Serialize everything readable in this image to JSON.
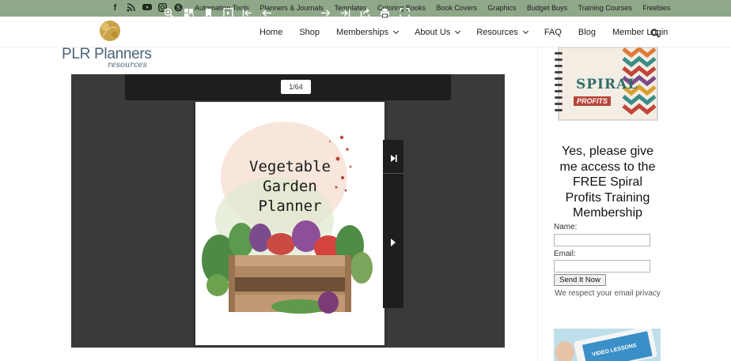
{
  "topbar": {
    "social_icons": [
      "facebook-icon",
      "rss-icon",
      "youtube-icon",
      "instagram-icon",
      "skype-icon"
    ],
    "links": [
      "Automation Tools",
      "Planners & Journals",
      "Templates",
      "Coloring Books",
      "Book Covers",
      "Graphics",
      "Budget Buys",
      "Training Courses",
      "Freebies"
    ],
    "bg_color": "#8fa889"
  },
  "logo": {
    "text": "PLR Planners",
    "subtext": "resources"
  },
  "mainnav": {
    "items": [
      {
        "label": "Home",
        "dropdown": false
      },
      {
        "label": "Shop",
        "dropdown": false
      },
      {
        "label": "Memberships",
        "dropdown": true
      },
      {
        "label": "About Us",
        "dropdown": true
      },
      {
        "label": "Resources",
        "dropdown": true
      },
      {
        "label": "FAQ",
        "dropdown": false
      },
      {
        "label": "Blog",
        "dropdown": false
      },
      {
        "label": "Member Login",
        "dropdown": false
      }
    ]
  },
  "viewer": {
    "page_indicator": "1/64",
    "toolbar_icons": [
      "zoom-in-icon",
      "thumbnails-icon",
      "bookmark-icon",
      "single-page-icon",
      "first-page-icon",
      "previous-page-icon",
      "next-page-icon",
      "last-page-icon",
      "share-icon",
      "print-icon",
      "fullscreen-icon"
    ],
    "cover": {
      "title_lines": [
        "Vegetable",
        "Garden",
        "Planner"
      ]
    }
  },
  "sidebar": {
    "promo_title_line1": "SPIRAL",
    "promo_title_line2": "PROFITS",
    "cta": "Yes, please give me access to the FREE Spiral Profits Training Membership",
    "name_label": "Name:",
    "email_label": "Email:",
    "name_value": "",
    "email_value": "",
    "submit_label": "Send It Now",
    "privacy_note": "We respect your email privacy",
    "video_label": "VIDEO LESSONS"
  }
}
